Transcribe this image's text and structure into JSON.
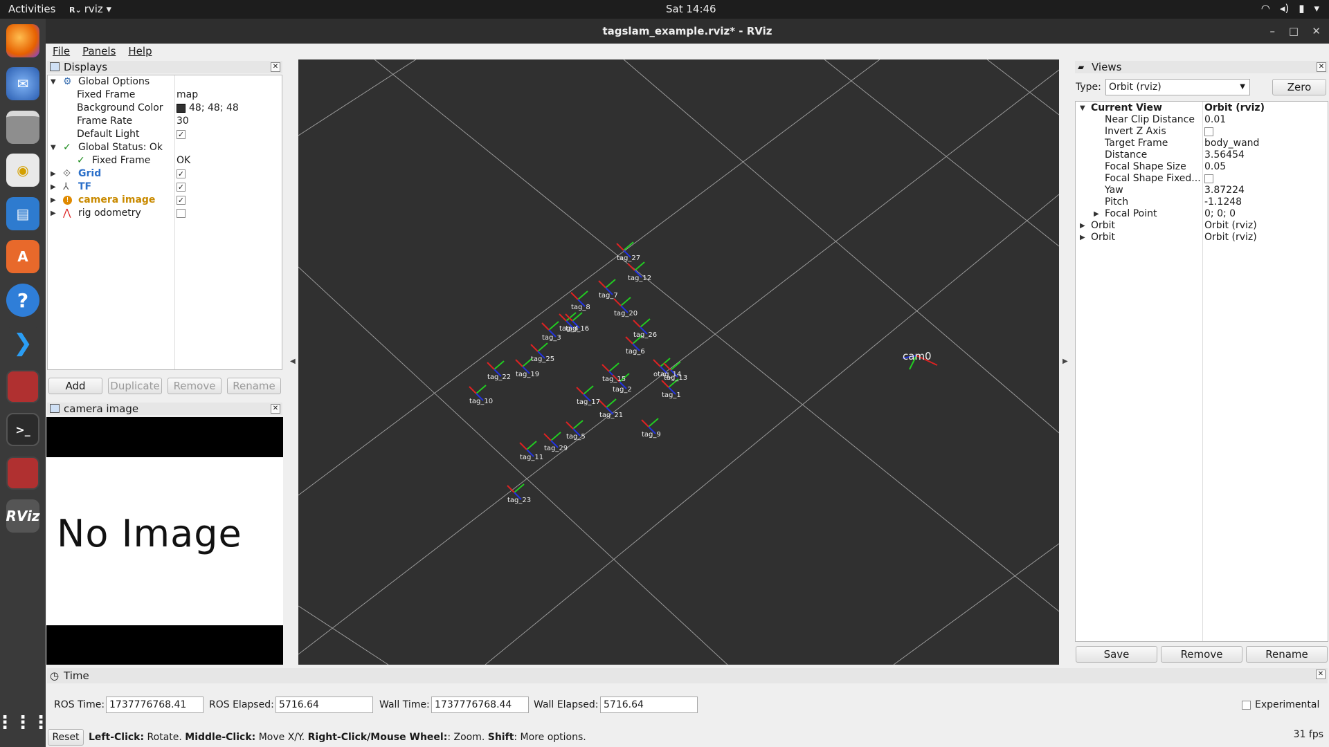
{
  "topbar": {
    "activities": "Activities",
    "app_menu": "rviz ▾",
    "app_icon": "rviz-small-icon",
    "clock": "Sat 14:46",
    "tray_icons": [
      "wifi-icon",
      "volume-icon",
      "battery-icon",
      "power-menu-icon"
    ]
  },
  "dock": {
    "icons": [
      "firefox-icon",
      "thunderbird-icon",
      "files-icon",
      "rhythmbox-icon",
      "writer-icon",
      "software-center-icon",
      "help-icon",
      "vscode-icon",
      "rqt-icon",
      "terminal-icon",
      "rqt-icon-2",
      "rviz-icon",
      "show-apps-icon"
    ],
    "rviz_label": "RViz"
  },
  "window": {
    "title": "tagslam_example.rviz* - RViz",
    "minimize": "–",
    "maximize": "□",
    "close": "✕"
  },
  "menu": {
    "file": "File",
    "panels": "Panels",
    "help": "Help"
  },
  "displays": {
    "title": "Displays",
    "rows": [
      {
        "label": "Global Options",
        "value": ""
      },
      {
        "label": "Fixed Frame",
        "value": "map"
      },
      {
        "label": "Background Color",
        "value": "48; 48; 48"
      },
      {
        "label": "Frame Rate",
        "value": "30"
      },
      {
        "label": "Default Light",
        "value": "✓"
      },
      {
        "label": "Global Status: Ok",
        "value": ""
      },
      {
        "label": "Fixed Frame",
        "value": "OK"
      },
      {
        "label": "Grid",
        "value": "✓"
      },
      {
        "label": "TF",
        "value": "✓"
      },
      {
        "label": "camera image",
        "value": "✓"
      },
      {
        "label": "rig odometry",
        "value": ""
      }
    ],
    "buttons": {
      "add": "Add",
      "duplicate": "Duplicate",
      "remove": "Remove",
      "rename": "Rename"
    },
    "colors": {
      "background_swatch": "#303030",
      "grid_label": "#2a6fc9",
      "warning_label": "#c98a00"
    }
  },
  "camera_panel": {
    "title": "camera image",
    "placeholder": "No Image"
  },
  "viewport": {
    "background": "#303030",
    "tag_labels": [
      "tag_27",
      "tag_12",
      "tag_7",
      "tag_8",
      "tag_20",
      "tag_26",
      "tag_4",
      "tag_16",
      "tag_3",
      "tag_6",
      "tag_25",
      "tag_22",
      "tag_19",
      "tag_15",
      "otag_14",
      "tag_13",
      "tag_10",
      "tag_2",
      "tag_1",
      "tag_17",
      "tag_21",
      "tag_5",
      "tag_9",
      "tag_29",
      "tag_11",
      "tag_23"
    ],
    "camera_label": "cam0",
    "fps": "31 fps"
  },
  "views": {
    "title": "Views",
    "type_label": "Type:",
    "type_value": "Orbit (rviz)",
    "zero_button": "Zero",
    "rows": [
      {
        "label": "Current View",
        "value": "Orbit (rviz)"
      },
      {
        "label": "Near Clip Distance",
        "value": "0.01"
      },
      {
        "label": "Invert Z Axis",
        "value": ""
      },
      {
        "label": "Target Frame",
        "value": "body_wand"
      },
      {
        "label": "Distance",
        "value": "3.56454"
      },
      {
        "label": "Focal Shape Size",
        "value": "0.05"
      },
      {
        "label": "Focal Shape Fixed...",
        "value": ""
      },
      {
        "label": "Yaw",
        "value": "3.87224"
      },
      {
        "label": "Pitch",
        "value": "-1.1248"
      },
      {
        "label": "Focal Point",
        "value": "0; 0; 0"
      },
      {
        "label": "Orbit",
        "value": "Orbit (rviz)"
      },
      {
        "label": "Orbit",
        "value": "Orbit (rviz)"
      }
    ],
    "buttons": {
      "save": "Save",
      "remove": "Remove",
      "rename": "Rename"
    }
  },
  "time": {
    "title": "Time",
    "ros_time_label": "ROS Time:",
    "ros_time": "1737776768.41",
    "ros_elapsed_label": "ROS Elapsed:",
    "ros_elapsed": "5716.64",
    "wall_time_label": "Wall Time:",
    "wall_time": "1737776768.44",
    "wall_elapsed_label": "Wall Elapsed:",
    "wall_elapsed": "5716.64",
    "experimental": "Experimental"
  },
  "statusbar": {
    "reset": "Reset",
    "hint_left_bold": "Left-Click:",
    "hint_left": " Rotate. ",
    "hint_middle_bold": "Middle-Click:",
    "hint_middle": " Move X/Y. ",
    "hint_right_bold": "Right-Click/Mouse Wheel:",
    "hint_right": ": Zoom. ",
    "hint_shift_bold": "Shift",
    "hint_shift": ": More options."
  }
}
